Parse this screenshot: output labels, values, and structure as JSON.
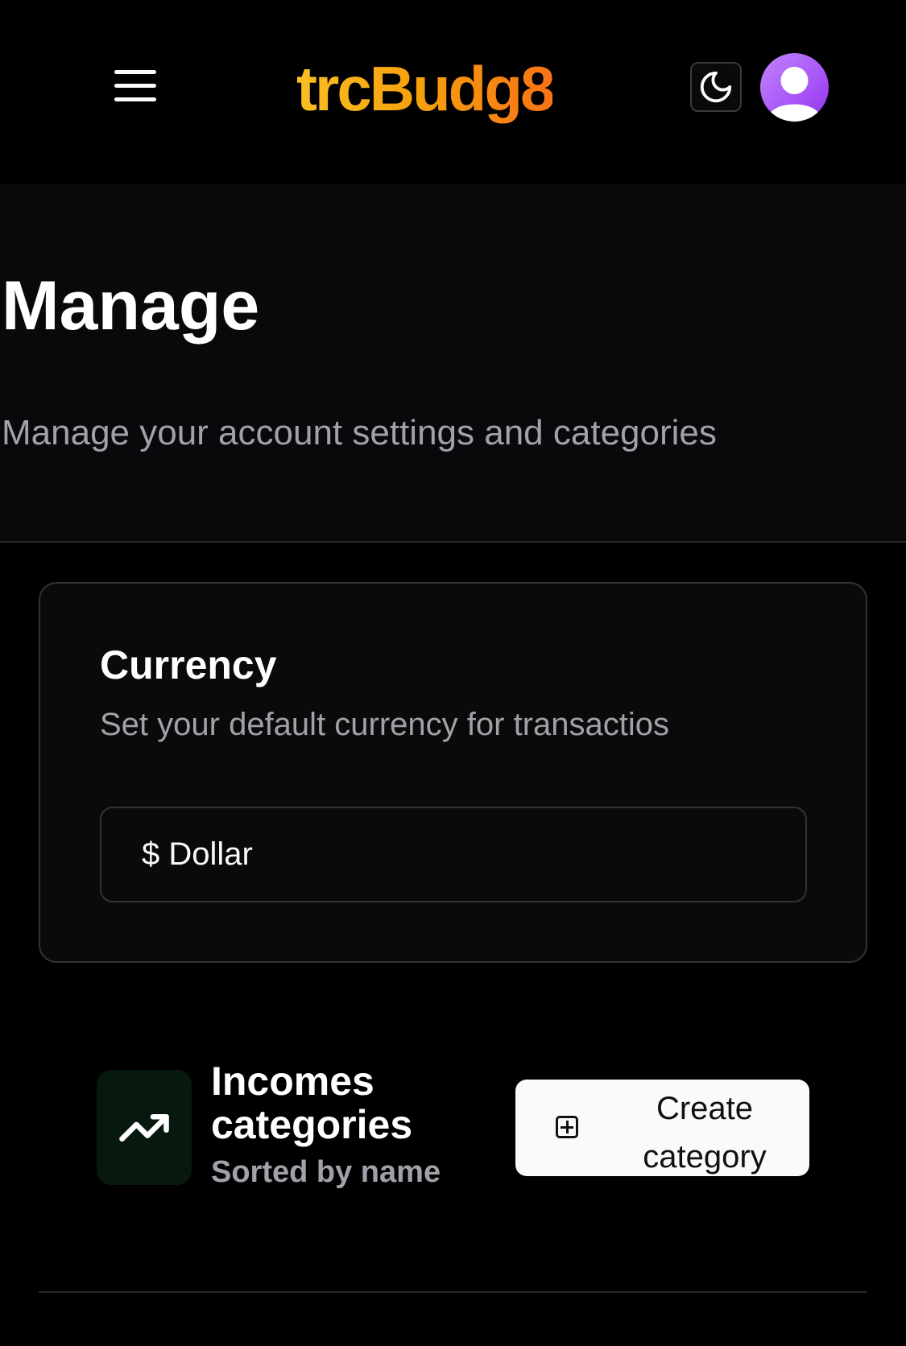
{
  "navbar": {
    "logo": "trcBudg8",
    "menu_icon": "hamburger-menu-icon",
    "theme_icon": "moon-icon",
    "avatar_icon": "user-avatar-icon"
  },
  "page": {
    "title": "Manage",
    "subtitle": "Manage your account settings and categories"
  },
  "currency_card": {
    "title": "Currency",
    "description": "Set your default currency for transactios",
    "selected_value": "$ Dollar"
  },
  "incomes_section": {
    "title": "Incomes categories",
    "subtitle": "Sorted by name",
    "icon": "trending-up-icon",
    "create_button_label": "Create category",
    "create_button_icon": "square-plus-icon"
  },
  "colors": {
    "background": "#000000",
    "surface": "#09090b",
    "border": "#333336",
    "muted_text": "#a1a1aa",
    "logo_gradient_start": "#fbbf24",
    "logo_gradient_end": "#f97316",
    "avatar": "#a855f7",
    "income_icon_bg": "#07180f"
  }
}
